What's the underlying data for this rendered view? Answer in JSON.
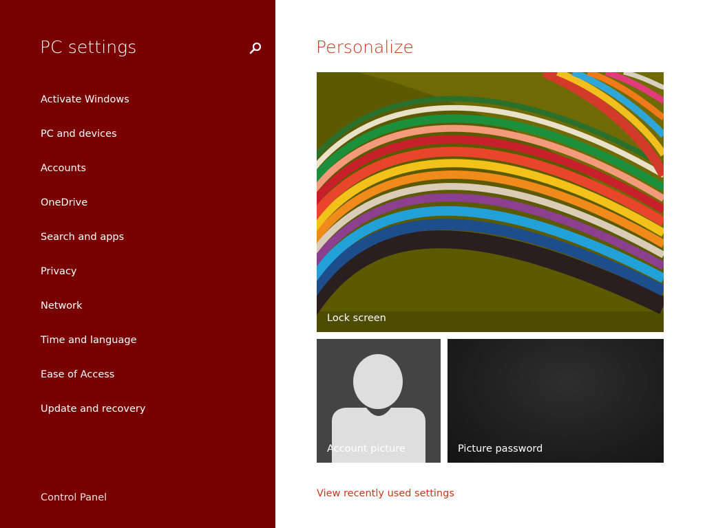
{
  "sidebar": {
    "title": "PC settings",
    "search_icon": "search-icon",
    "items": [
      {
        "label": "Activate Windows"
      },
      {
        "label": "PC and devices"
      },
      {
        "label": "Accounts"
      },
      {
        "label": "OneDrive"
      },
      {
        "label": "Search and apps"
      },
      {
        "label": "Privacy"
      },
      {
        "label": "Network"
      },
      {
        "label": "Time and language"
      },
      {
        "label": "Ease of Access"
      },
      {
        "label": "Update and recovery"
      }
    ],
    "footer_label": "Control Panel"
  },
  "main": {
    "title": "Personalize",
    "tiles": {
      "lock_screen": "Lock screen",
      "account_picture": "Account picture",
      "picture_password": "Picture password"
    },
    "recent_link": "View recently used settings"
  },
  "colors": {
    "sidebar_bg": "#780000",
    "accent": "#c8361b",
    "text_on_sidebar": "#ffffff"
  }
}
